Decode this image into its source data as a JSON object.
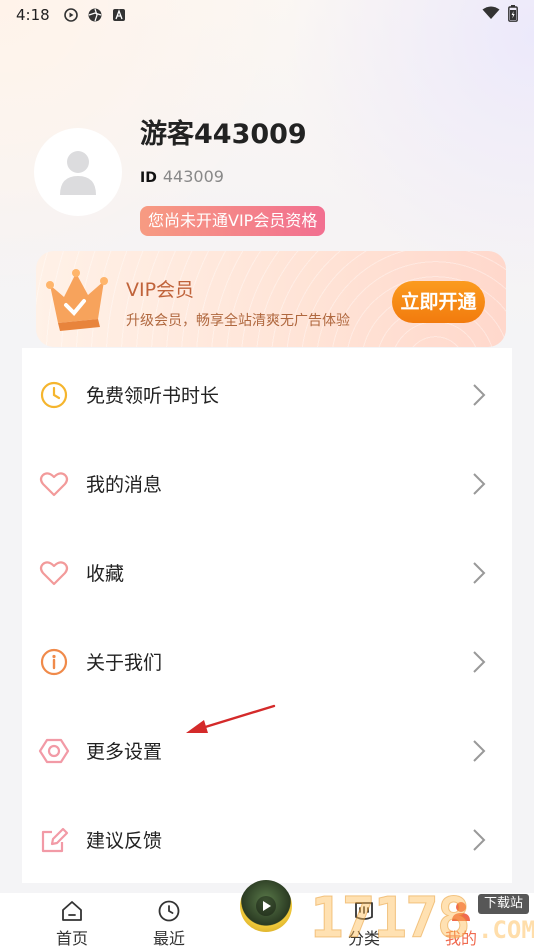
{
  "status_bar": {
    "time": "4:18",
    "left_icons": [
      "play-circle-icon",
      "aperture-icon",
      "a-badge-icon"
    ],
    "right_icons": [
      "wifi-icon",
      "battery-icon"
    ]
  },
  "profile": {
    "username": "游客443009",
    "id_label": "ID",
    "id_value": "443009",
    "vip_status": "您尚未开通VIP会员资格"
  },
  "vip_card": {
    "title": "VIP会员",
    "subtitle": "升级会员，畅享全站清爽无广告体验",
    "button_label": "立即开通"
  },
  "menu": {
    "items": [
      {
        "label": "免费领听书时长",
        "icon": "clock-icon"
      },
      {
        "label": "我的消息",
        "icon": "heart-icon"
      },
      {
        "label": "收藏",
        "icon": "heart-icon"
      },
      {
        "label": "关于我们",
        "icon": "info-icon"
      },
      {
        "label": "更多设置",
        "icon": "settings-hexagon-icon"
      },
      {
        "label": "建议反馈",
        "icon": "edit-icon"
      }
    ]
  },
  "bottom_nav": {
    "items": [
      {
        "label": "首页",
        "icon": "home-icon"
      },
      {
        "label": "最近",
        "icon": "clock-icon"
      },
      {
        "label": "分类",
        "icon": "category-icon"
      },
      {
        "label": "我的",
        "icon": "user-icon",
        "active": true
      }
    ]
  },
  "watermark": {
    "digits": "17178",
    "tag": "下载站",
    "suffix": ".COM"
  },
  "colors": {
    "accent_orange": "#f27b0e",
    "active_nav": "#f06a4f",
    "annotation_arrow": "#d42a2a"
  }
}
